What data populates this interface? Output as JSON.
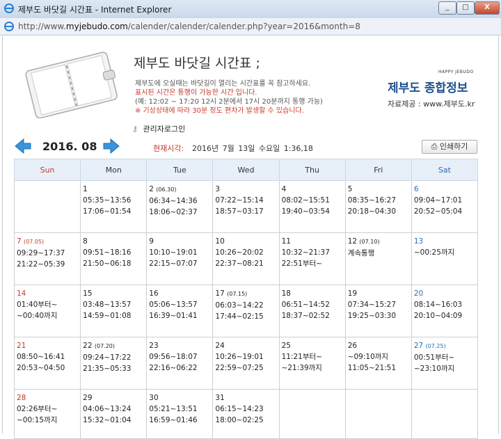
{
  "window": {
    "title": "제부도 바닷길 시간표 - Internet Explorer",
    "url_prefix": "http://www.",
    "url_domain": "myjebudo.com",
    "url_path": "/calender/calender/calender.php?year=2016&month=8",
    "btn_min": "_",
    "btn_max": "□",
    "btn_close": "X"
  },
  "header": {
    "title": "제부도 바닷길 시간표 ;",
    "line1": "제부도에 오실때는 바닷길이 열리는 시간표를 꼭 참고하세요.",
    "line2": "표시된 시간은 통행이 가능한 시간 입니다.",
    "line3": "(예: 12:02 ~ 17:20 12시 2분에서 17시 20분까지 통행 가능)",
    "line4": "※ 기상상태에 따라 30분 정도 편차가 발생할 수 있습니다.",
    "happy": "HAPPY JEBUDO",
    "brand": "제부도 종합정보",
    "credit": "자료제공 : www.제부도.kr",
    "login": "관리자로그인"
  },
  "nav": {
    "month": "2016. 08",
    "current_label": "현재시각:",
    "current_value": "2016년 7월 13일  수요일    1:36,18",
    "print": "인쇄하기"
  },
  "weekdays": [
    "Sun",
    "Mon",
    "Tue",
    "Wed",
    "Thu",
    "Fri",
    "Sat"
  ],
  "weeks": [
    [
      {
        "day": "",
        "sub": "",
        "lines": []
      },
      {
        "day": "1",
        "sub": "",
        "lines": [
          "05:35~13:56",
          "17:06~01:54"
        ]
      },
      {
        "day": "2",
        "sub": "(06.30)",
        "lines": [
          "06:34~14:36",
          "18:06~02:37"
        ]
      },
      {
        "day": "3",
        "sub": "",
        "lines": [
          "07:22~15:14",
          "18:57~03:17"
        ]
      },
      {
        "day": "4",
        "sub": "",
        "lines": [
          "08:02~15:51",
          "19:40~03:54"
        ]
      },
      {
        "day": "5",
        "sub": "",
        "lines": [
          "08:35~16:27",
          "20:18~04:30"
        ]
      },
      {
        "day": "6",
        "sub": "",
        "lines": [
          "09:04~17:01",
          "20:52~05:04"
        ]
      }
    ],
    [
      {
        "day": "7",
        "sub": "(07.05)",
        "lines": [
          "09:29~17:37",
          "21:22~05:39"
        ]
      },
      {
        "day": "8",
        "sub": "",
        "lines": [
          "09:51~18:16",
          "21:50~06:18"
        ]
      },
      {
        "day": "9",
        "sub": "",
        "lines": [
          "10:10~19:01",
          "22:15~07:07"
        ]
      },
      {
        "day": "10",
        "sub": "",
        "lines": [
          "10:26~20:02",
          "22:37~08:21"
        ]
      },
      {
        "day": "11",
        "sub": "",
        "lines": [
          "10:32~21:37",
          "22:51부터~"
        ]
      },
      {
        "day": "12",
        "sub": "(07.10)",
        "lines": [
          "계속통행"
        ]
      },
      {
        "day": "13",
        "sub": "",
        "lines": [
          "~00:25까지"
        ]
      }
    ],
    [
      {
        "day": "14",
        "sub": "",
        "lines": [
          "01:40부터~",
          "~00:40까지"
        ]
      },
      {
        "day": "15",
        "sub": "",
        "lines": [
          "03:48~13:57",
          "14:59~01:08"
        ]
      },
      {
        "day": "16",
        "sub": "",
        "lines": [
          "05:06~13:57",
          "16:39~01:41"
        ]
      },
      {
        "day": "17",
        "sub": "(07.15)",
        "lines": [
          "06:03~14:22",
          "17:44~02:15"
        ]
      },
      {
        "day": "18",
        "sub": "",
        "lines": [
          "06:51~14:52",
          "18:37~02:52"
        ]
      },
      {
        "day": "19",
        "sub": "",
        "lines": [
          "07:34~15:27",
          "19:25~03:30"
        ]
      },
      {
        "day": "20",
        "sub": "",
        "lines": [
          "08:14~16:03",
          "20:10~04:09"
        ]
      }
    ],
    [
      {
        "day": "21",
        "sub": "",
        "lines": [
          "08:50~16:41",
          "20:53~04:50"
        ]
      },
      {
        "day": "22",
        "sub": "(07.20)",
        "lines": [
          "09:24~17:22",
          "21:35~05:33"
        ]
      },
      {
        "day": "23",
        "sub": "",
        "lines": [
          "09:56~18:07",
          "22:16~06:22"
        ]
      },
      {
        "day": "24",
        "sub": "",
        "lines": [
          "10:26~19:01",
          "22:59~07:25"
        ]
      },
      {
        "day": "25",
        "sub": "",
        "lines": [
          "11:21부터~",
          "~21:39까지"
        ]
      },
      {
        "day": "26",
        "sub": "",
        "lines": [
          "~09:10까지",
          "11:05~21:51"
        ]
      },
      {
        "day": "27",
        "sub": "(07.25)",
        "lines": [
          "00:51부터~",
          "~23:10까지"
        ]
      }
    ],
    [
      {
        "day": "28",
        "sub": "",
        "lines": [
          "02:26부터~",
          "~00:15까지"
        ]
      },
      {
        "day": "29",
        "sub": "",
        "lines": [
          "04:06~13:24",
          "15:32~01:04"
        ]
      },
      {
        "day": "30",
        "sub": "",
        "lines": [
          "05:21~13:51",
          "16:59~01:46"
        ]
      },
      {
        "day": "31",
        "sub": "",
        "lines": [
          "06:15~14:23",
          "18:00~02:25"
        ]
      },
      {
        "day": "",
        "sub": "",
        "lines": []
      },
      {
        "day": "",
        "sub": "",
        "lines": []
      },
      {
        "day": "",
        "sub": "",
        "lines": []
      }
    ]
  ],
  "colors": {
    "sunday": "#c0392b",
    "saturday": "#2a6cb8",
    "brand": "#1f4f8f",
    "header_bg": "#e7f0f8"
  }
}
